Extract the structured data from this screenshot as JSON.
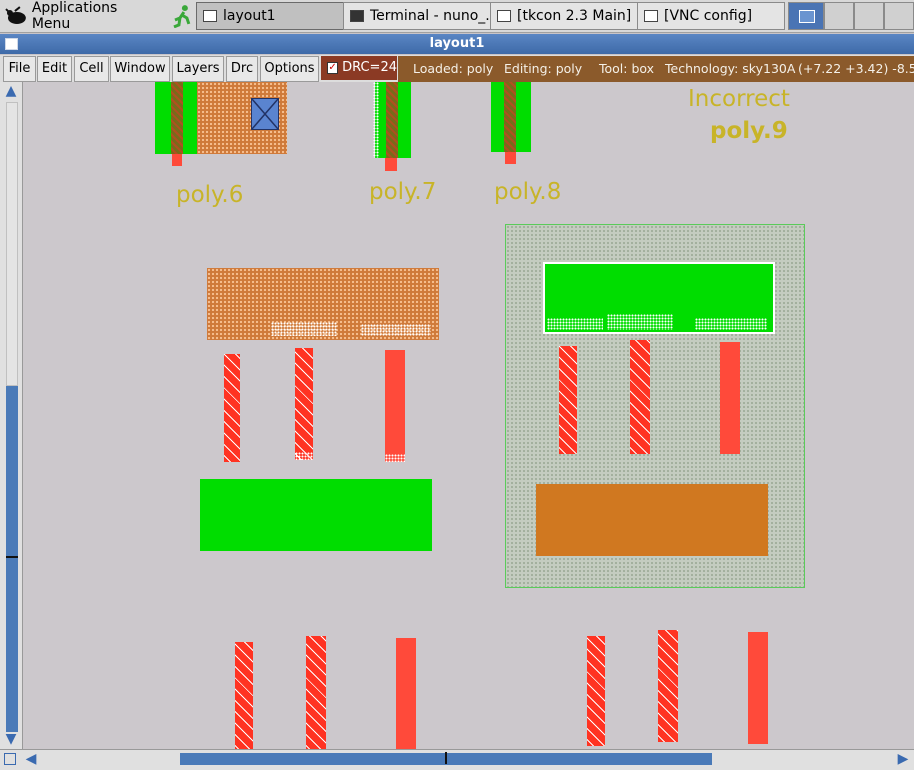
{
  "taskbar": {
    "app_menu_label": "Applications Menu",
    "tasks": [
      {
        "label": "layout1",
        "active": true
      },
      {
        "label": "Terminal - nuno_...",
        "active": false
      },
      {
        "label": "[tkcon 2.3 Main]",
        "active": false
      },
      {
        "label": "[VNC config]",
        "active": false
      }
    ]
  },
  "window": {
    "title": "layout1"
  },
  "menubar": {
    "items": [
      "File",
      "Edit",
      "Cell",
      "Window",
      "Layers",
      "Drc",
      "Options"
    ],
    "drc_label": "DRC=24",
    "status": {
      "loaded": "Loaded: poly",
      "editing": "Editing: poly",
      "tool": "Tool: box",
      "technology": "Technology: sky130A",
      "coords": "(+7.22 +3.42) -8.5"
    }
  },
  "canvas": {
    "labels": {
      "poly6": "poly.6",
      "poly7": "poly.7",
      "poly8": "poly.8",
      "incorrect": "Incorrect",
      "poly9": "poly.9"
    }
  },
  "colors": {
    "ndiff": "#00dd00",
    "poly": "#ff4a3a",
    "pdiff": "#cf7a3a",
    "nwell": "#c4ccc0",
    "label": "#c8b428",
    "titlebar": "#4a78b8",
    "status_bg": "#8b5a2b",
    "drc_bg": "#8b3a24"
  }
}
